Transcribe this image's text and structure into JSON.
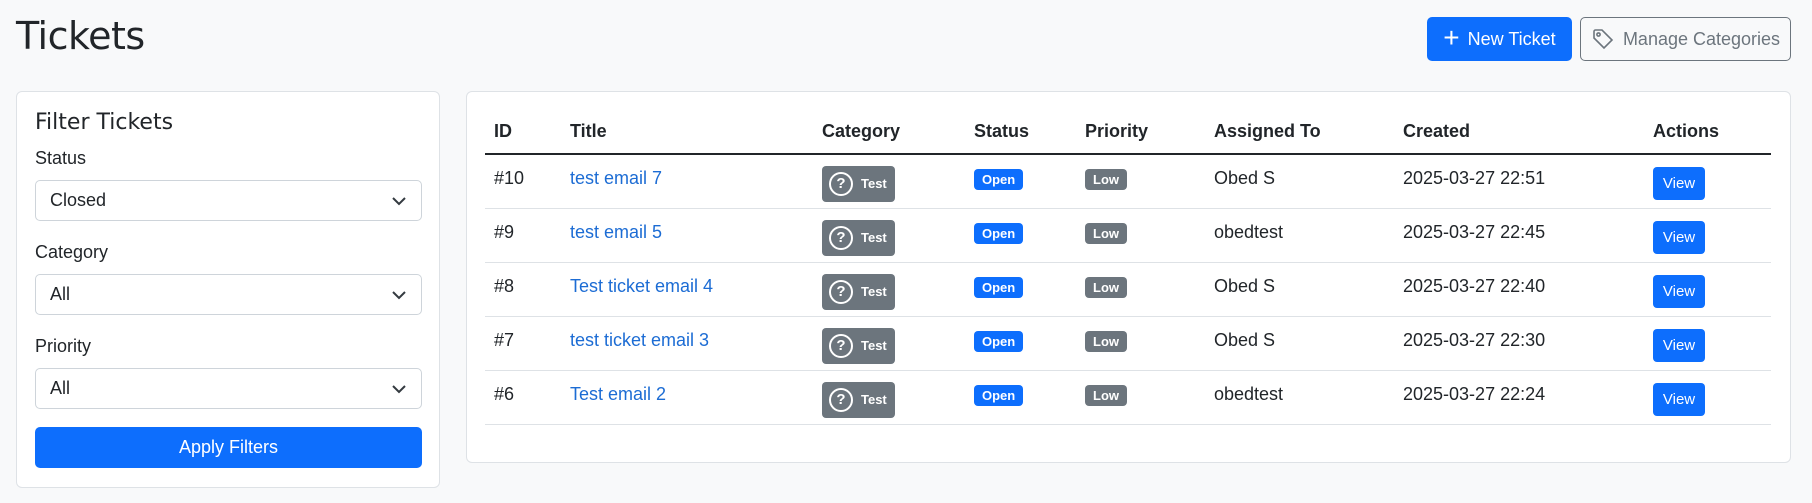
{
  "page": {
    "title": "Tickets"
  },
  "header": {
    "new_ticket_label": "New Ticket",
    "manage_categories_label": "Manage Categories"
  },
  "filters": {
    "title": "Filter Tickets",
    "status_label": "Status",
    "status_value": "Closed",
    "category_label": "Category",
    "category_value": "All",
    "priority_label": "Priority",
    "priority_value": "All",
    "apply_label": "Apply Filters"
  },
  "table": {
    "headers": [
      "ID",
      "Title",
      "Category",
      "Status",
      "Priority",
      "Assigned To",
      "Created",
      "Actions"
    ],
    "rows": [
      {
        "id": "#10",
        "title": "test email 7",
        "category": "Test",
        "status": "Open",
        "priority": "Low",
        "assigned_to": "Obed S",
        "created": "2025-03-27 22:51",
        "action": "View"
      },
      {
        "id": "#9",
        "title": "test email 5",
        "category": "Test",
        "status": "Open",
        "priority": "Low",
        "assigned_to": "obedtest",
        "created": "2025-03-27 22:45",
        "action": "View"
      },
      {
        "id": "#8",
        "title": "Test ticket email 4",
        "category": "Test",
        "status": "Open",
        "priority": "Low",
        "assigned_to": "Obed S",
        "created": "2025-03-27 22:40",
        "action": "View"
      },
      {
        "id": "#7",
        "title": "test ticket email 3",
        "category": "Test",
        "status": "Open",
        "priority": "Low",
        "assigned_to": "Obed S",
        "created": "2025-03-27 22:30",
        "action": "View"
      },
      {
        "id": "#6",
        "title": "Test email 2",
        "category": "Test",
        "status": "Open",
        "priority": "Low",
        "assigned_to": "obedtest",
        "created": "2025-03-27 22:24",
        "action": "View"
      }
    ]
  },
  "icons": {
    "new_ticket": "plus-icon",
    "manage_categories": "tag-icon",
    "category": "question-circle-icon",
    "select": "chevron-down-icon"
  },
  "colors": {
    "primary": "#0d6efd",
    "secondary": "#6c757d",
    "link": "#1c6cd4",
    "background": "#f8f9fa"
  }
}
